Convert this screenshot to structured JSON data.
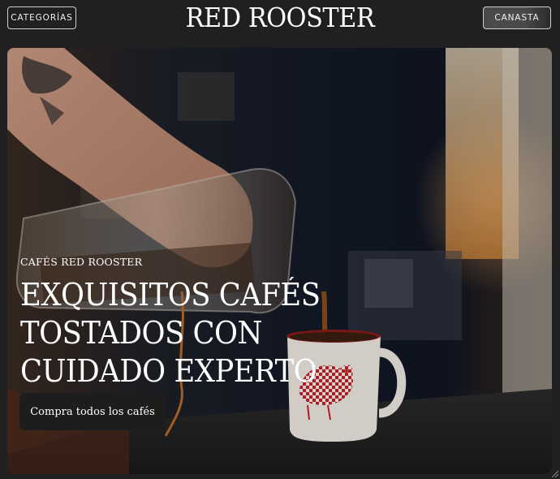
{
  "header": {
    "categories_label": "CATEGORÍAS",
    "brand": "RED ROOSTER",
    "cart_label": "CANASTA"
  },
  "hero": {
    "image_alt": "",
    "kicker": "CAFÉS RED ROOSTER",
    "headline_lines": [
      "EXQUISITOS CAFÉS",
      "TOSTADOS CON",
      "CUIDADO EXPERTO"
    ],
    "cta_label": "Compra todos los cafés"
  },
  "colors": {
    "background": "#202020",
    "text": "#ffffff",
    "cta_background": "#1d1d1d",
    "mug_pattern": "#c8202a"
  }
}
